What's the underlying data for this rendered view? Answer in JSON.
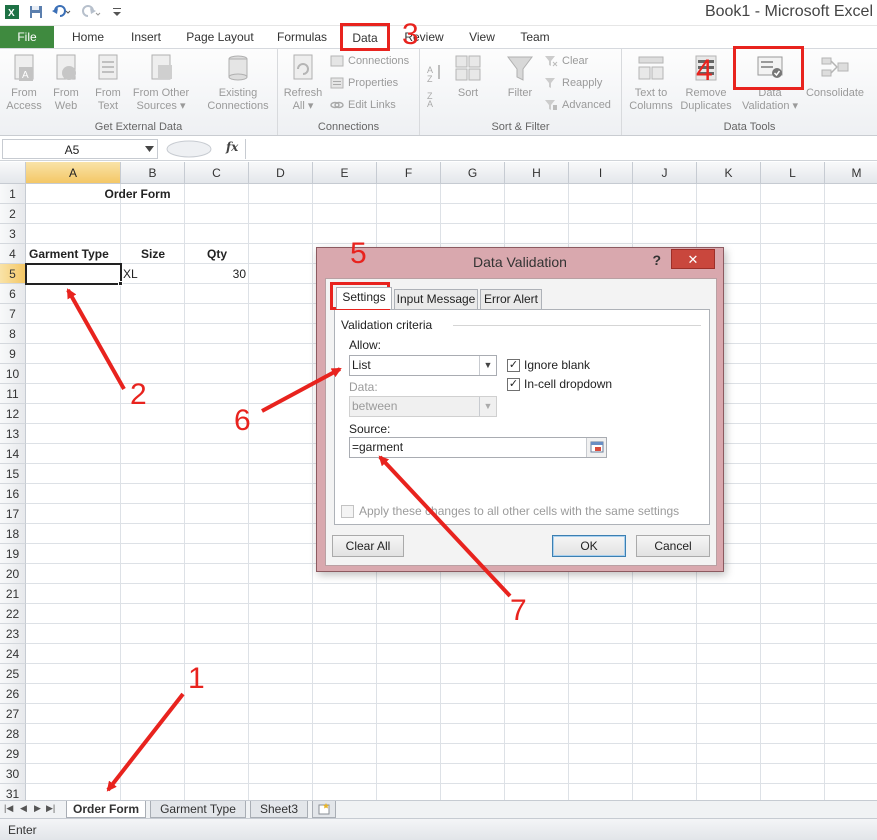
{
  "title_bar": {
    "app_title": "Book1 - Microsoft Excel",
    "qat_icons": [
      "excel-logo-icon",
      "save-icon",
      "undo-icon",
      "redo-icon",
      "customize-qat-icon"
    ]
  },
  "ribbon": {
    "tabs": [
      "File",
      "Home",
      "Insert",
      "Page Layout",
      "Formulas",
      "Data",
      "Review",
      "View",
      "Team"
    ],
    "active_tab": "Data",
    "groups": {
      "get_external_data": {
        "label": "Get External Data",
        "buttons": [
          "From\nAccess",
          "From\nWeb",
          "From\nText",
          "From Other\nSources ▾",
          "Existing\nConnections"
        ]
      },
      "connections": {
        "label": "Connections",
        "refresh": "Refresh\nAll ▾",
        "small": [
          "Connections",
          "Properties",
          "Edit Links"
        ]
      },
      "sort_filter": {
        "label": "Sort & Filter",
        "sort": "Sort",
        "filter": "Filter",
        "small": [
          "Clear",
          "Reapply",
          "Advanced"
        ]
      },
      "data_tools": {
        "label": "Data Tools",
        "buttons": [
          "Text to\nColumns",
          "Remove\nDuplicates",
          "Data\nValidation ▾",
          "Consolidate"
        ]
      }
    }
  },
  "formula_bar": {
    "name_box": "A5",
    "fx": "fx",
    "content": ""
  },
  "sheet": {
    "columns": [
      "A",
      "B",
      "C",
      "D",
      "E",
      "F",
      "G",
      "H",
      "I",
      "J",
      "K",
      "L",
      "M"
    ],
    "selected_column": "A",
    "selected_row": "5",
    "rows": [
      "1",
      "2",
      "3",
      "4",
      "5",
      "6",
      "7",
      "8",
      "9",
      "10",
      "11",
      "12",
      "13",
      "14",
      "15",
      "16",
      "17",
      "18",
      "19",
      "20",
      "21",
      "22",
      "23",
      "24",
      "25",
      "26",
      "27",
      "28",
      "29",
      "30",
      "31"
    ],
    "cells": {
      "B1": "Order Form",
      "A4": "Garment Type",
      "B4": "Size",
      "C4": "Qty",
      "B5": "XL",
      "C5": "30"
    }
  },
  "sheet_tabs": {
    "tabs": [
      "Order Form",
      "Garment Type",
      "Sheet3"
    ],
    "active": "Order Form"
  },
  "status_bar": {
    "mode": "Enter"
  },
  "dialog": {
    "title": "Data Validation",
    "help": "?",
    "close": "✕",
    "tabs": [
      "Settings",
      "Input Message",
      "Error Alert"
    ],
    "active_tab": "Settings",
    "section_label": "Validation criteria",
    "allow_label": "Allow:",
    "allow_value": "List",
    "data_label": "Data:",
    "data_value": "between",
    "source_label": "Source:",
    "source_value": "=garment",
    "ignore_blank": {
      "label": "Ignore blank",
      "checked": true
    },
    "in_cell_dropdown": {
      "label": "In-cell dropdown",
      "checked": true
    },
    "apply_all": {
      "label": "Apply these changes to all other cells with the same settings",
      "checked": false
    },
    "clear_all_button": "Clear All",
    "ok_button": "OK",
    "cancel_button": "Cancel"
  },
  "annotations": {
    "labels": [
      "1",
      "2",
      "3",
      "4",
      "5",
      "6",
      "7"
    ],
    "color": "#e8231e"
  },
  "colors": {
    "file_tab": "#3f8a3f",
    "selection_header": "#f4c766",
    "dialog_frame": "#d9a8ae",
    "close_button": "#c9473d"
  }
}
